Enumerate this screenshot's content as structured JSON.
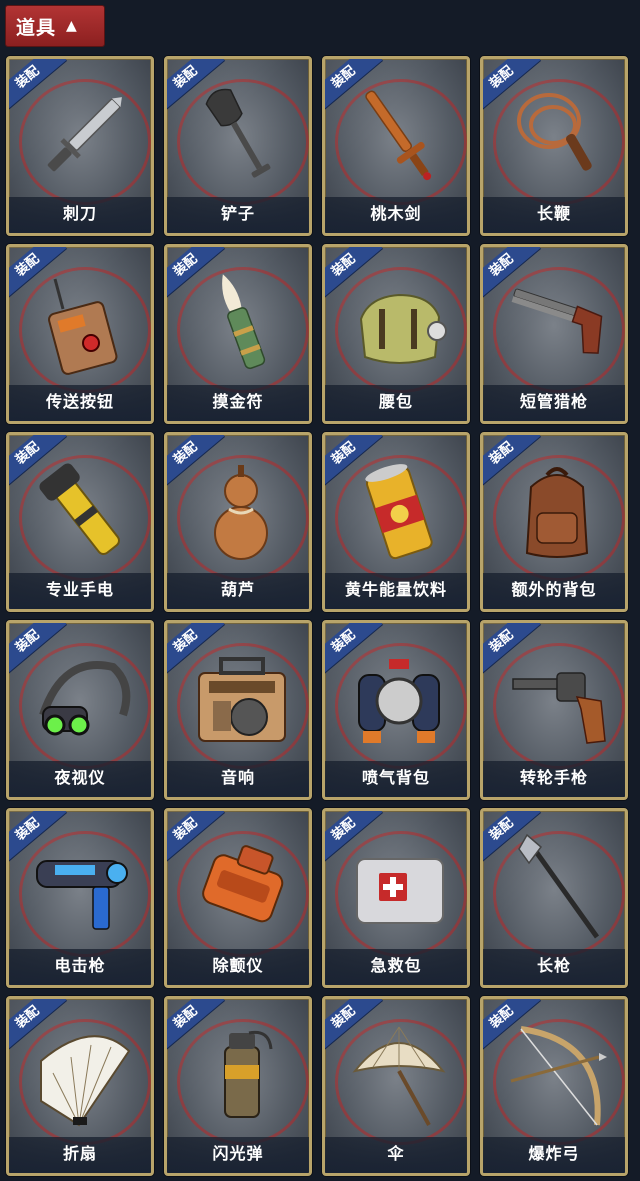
{
  "header": {
    "title": "道具",
    "caret_icon": "chevron-up-icon"
  },
  "equip_tag": "装配",
  "items": [
    {
      "label": "刺刀",
      "icon": "knife-icon"
    },
    {
      "label": "铲子",
      "icon": "shovel-icon"
    },
    {
      "label": "桃木剑",
      "icon": "wooden-sword-icon"
    },
    {
      "label": "长鞭",
      "icon": "whip-icon"
    },
    {
      "label": "传送按钮",
      "icon": "teleport-button-icon"
    },
    {
      "label": "摸金符",
      "icon": "talisman-icon"
    },
    {
      "label": "腰包",
      "icon": "waist-bag-icon"
    },
    {
      "label": "短管猎枪",
      "icon": "shotgun-icon"
    },
    {
      "label": "专业手电",
      "icon": "flashlight-icon"
    },
    {
      "label": "葫芦",
      "icon": "gourd-icon"
    },
    {
      "label": "黄牛能量饮料",
      "icon": "energy-drink-icon"
    },
    {
      "label": "额外的背包",
      "icon": "backpack-icon"
    },
    {
      "label": "夜视仪",
      "icon": "night-vision-icon"
    },
    {
      "label": "音响",
      "icon": "radio-icon"
    },
    {
      "label": "喷气背包",
      "icon": "jetpack-icon"
    },
    {
      "label": "转轮手枪",
      "icon": "revolver-icon"
    },
    {
      "label": "电击枪",
      "icon": "shock-gun-icon"
    },
    {
      "label": "除颤仪",
      "icon": "defibrillator-icon"
    },
    {
      "label": "急救包",
      "icon": "first-aid-kit-icon"
    },
    {
      "label": "长枪",
      "icon": "spear-icon"
    },
    {
      "label": "折扇",
      "icon": "folding-fan-icon"
    },
    {
      "label": "闪光弹",
      "icon": "flash-grenade-icon"
    },
    {
      "label": "伞",
      "icon": "umbrella-icon"
    },
    {
      "label": "爆炸弓",
      "icon": "bow-icon"
    }
  ]
}
